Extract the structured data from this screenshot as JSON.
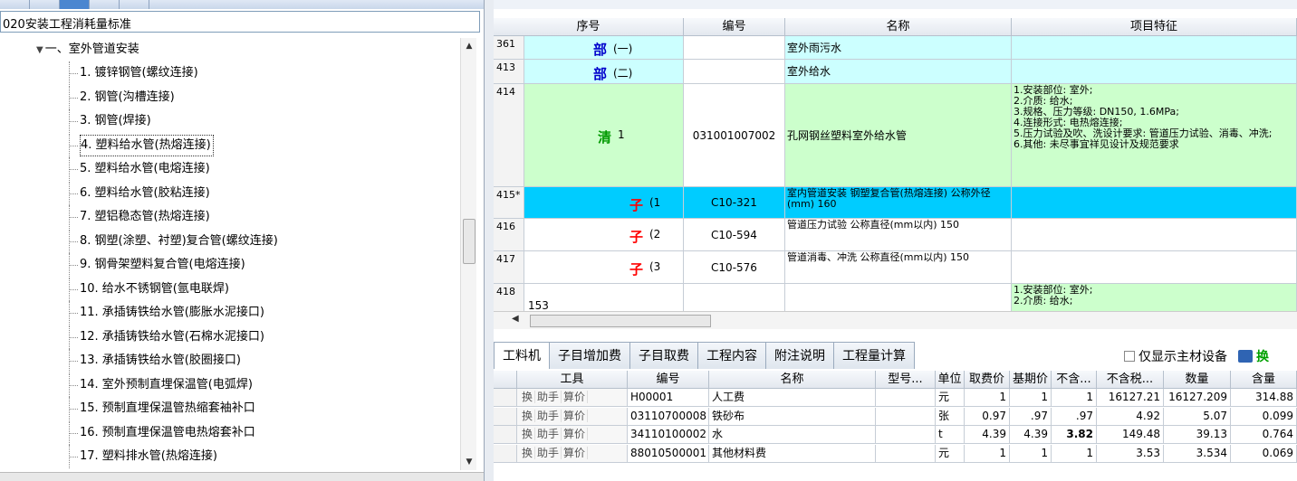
{
  "left": {
    "library_name": "020安装工程消耗量标准",
    "tree_root": "一、室外管道安装",
    "items": [
      "1. 镀锌钢管(螺纹连接)",
      "2. 钢管(沟槽连接)",
      "3. 钢管(焊接)",
      "4. 塑料给水管(热熔连接)",
      "5. 塑料给水管(电熔连接)",
      "6. 塑料给水管(胶粘连接)",
      "7. 塑铝稳态管(热熔连接)",
      "8. 钢塑(涂塑、衬塑)复合管(螺纹连接)",
      "9. 钢骨架塑料复合管(电熔连接)",
      "10. 给水不锈钢管(氩电联焊)",
      "11. 承插铸铁给水管(膨胀水泥接口)",
      "12. 承插铸铁给水管(石棉水泥接口)",
      "13. 承插铸铁给水管(胶圈接口)",
      "14. 室外预制直埋保温管(电弧焊)",
      "15. 预制直埋保温管热缩套袖补口",
      "16. 预制直埋保温管电热熔套补口",
      "17. 塑料排水管(热熔连接)"
    ],
    "selected_index": 3
  },
  "grid": {
    "headers": {
      "seq": "序号",
      "code": "编号",
      "name": "名称",
      "feature": "项目特征"
    },
    "rows": [
      {
        "rn": "361",
        "level": "部",
        "seq": "(一)",
        "code": "",
        "name": "室外雨污水",
        "feature": ""
      },
      {
        "rn": "413",
        "level": "部",
        "seq": "(二)",
        "code": "",
        "name": "室外给水",
        "feature": ""
      },
      {
        "rn": "414",
        "level": "清",
        "seq": "1",
        "code": "031001007002",
        "name": "孔网钢丝塑料室外给水管",
        "feature": "1.安装部位: 室外;\n2.介质: 给水;\n3.规格、压力等级: DN150, 1.6MPa;\n4.连接形式: 电热熔连接;\n5.压力试验及吹、洗设计要求: 管道压力试验、消毒、冲洗;\n6.其他: 未尽事宜祥见设计及规范要求"
      },
      {
        "rn": "415*",
        "level": "子",
        "seq": "(1",
        "code": "C10-321",
        "name": "室内管道安装 钢塑复合管(热熔连接) 公称外径(mm) 160",
        "feature": ""
      },
      {
        "rn": "416",
        "level": "子",
        "seq": "(2",
        "code": "C10-594",
        "name": "管道压力试验 公称直径(mm以内) 150",
        "feature": ""
      },
      {
        "rn": "417",
        "level": "子",
        "seq": "(3",
        "code": "C10-576",
        "name": "管道消毒、冲洗 公称直径(mm以内) 150",
        "feature": ""
      },
      {
        "rn": "418",
        "level": "",
        "seq": "153",
        "code": "",
        "name": "",
        "feature": "1.安装部位: 室外;\n2.介质: 给水;"
      }
    ]
  },
  "lower": {
    "tabs": [
      "工料机",
      "子目增加费",
      "子目取费",
      "工程内容",
      "附注说明",
      "工程量计算"
    ],
    "active_tab": 0,
    "only_main_label": "仅显示主材设备",
    "swap_label": "换",
    "headers": [
      "工具",
      "编号",
      "名称",
      "型号...",
      "单位",
      "取费价",
      "基期价",
      "不含...",
      "不含税...",
      "数量",
      "含量"
    ],
    "tool_labels": [
      "换",
      "助手",
      "算价"
    ],
    "rows": [
      {
        "code": "H00001",
        "name": "人工费",
        "model": "",
        "unit": "元",
        "fee_price": "1",
        "base_price": "1",
        "excl": "1",
        "excl_tax": "16127.21",
        "qty": "16127.209",
        "content": "314.88"
      },
      {
        "code": "03110700008",
        "name": "铁砂布",
        "model": "",
        "unit": "张",
        "fee_price": "0.97",
        "base_price": ".97",
        "excl": ".97",
        "excl_tax": "4.92",
        "qty": "5.07",
        "content": "0.099"
      },
      {
        "code": "34110100002",
        "name": "水",
        "model": "",
        "unit": "t",
        "fee_price": "4.39",
        "base_price": "4.39",
        "excl": "3.82",
        "excl_tax": "149.48",
        "qty": "39.13",
        "content": "0.764"
      },
      {
        "code": "88010500001",
        "name": "其他材料费",
        "model": "",
        "unit": "元",
        "fee_price": "1",
        "base_price": "1",
        "excl": "1",
        "excl_tax": "3.53",
        "qty": "3.534",
        "content": "0.069"
      }
    ]
  }
}
